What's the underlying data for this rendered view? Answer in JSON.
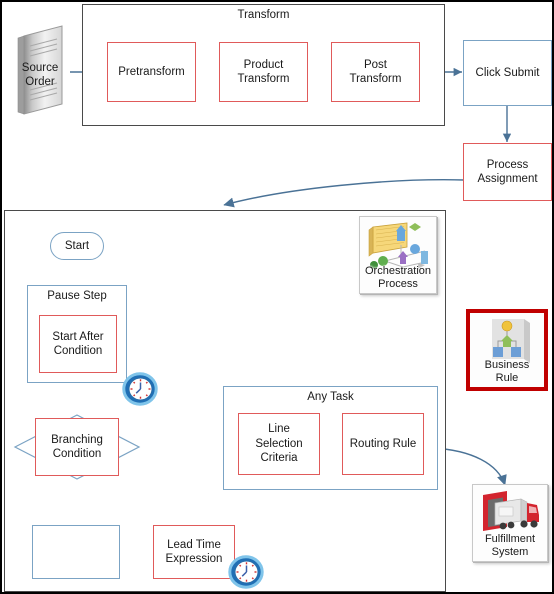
{
  "diagram": {
    "title": "Order Orchestration Flow",
    "colors": {
      "red_border": "#e05a5a",
      "blue_border": "#7ba3c4",
      "dark_border": "#4a4a4a",
      "connector": "#4a7296",
      "highlight_red": "#c00000"
    }
  },
  "top_section": {
    "source_order": {
      "label": "Source\nOrder",
      "icon": "document-stack-icon"
    },
    "transform_group": {
      "title": "Transform",
      "steps": [
        {
          "label": "Pretransform"
        },
        {
          "label": "Product\nTransform"
        },
        {
          "label": "Post\nTransform"
        }
      ]
    },
    "click_submit": {
      "label": "Click Submit"
    },
    "process_assignment": {
      "label": "Process\nAssignment"
    }
  },
  "bottom_section": {
    "start": {
      "label": "Start"
    },
    "pause_step": {
      "title": "Pause Step",
      "inner": {
        "label": "Start After\nCondition"
      },
      "clock_badge": "clock-icon"
    },
    "branching_condition": {
      "label": "Branching\nCondition"
    },
    "empty_step": {
      "label": ""
    },
    "lead_time_expression": {
      "label": "Lead Time\nExpression",
      "clock_badge": "clock-icon"
    },
    "any_task_group": {
      "title": "Any Task",
      "steps": [
        {
          "label": "Line\nSelection\nCriteria"
        },
        {
          "label": "Routing Rule"
        }
      ]
    }
  },
  "side_icons": {
    "orchestration_process": {
      "caption": "Orchestration\nProcess",
      "icon": "orchestration-process-icon",
      "highlighted": false
    },
    "business_rule": {
      "caption": "Business\nRule",
      "icon": "business-rule-icon",
      "highlighted": true
    },
    "fulfillment_system": {
      "caption": "Fulfillment\nSystem",
      "icon": "truck-dock-icon",
      "highlighted": false
    }
  }
}
